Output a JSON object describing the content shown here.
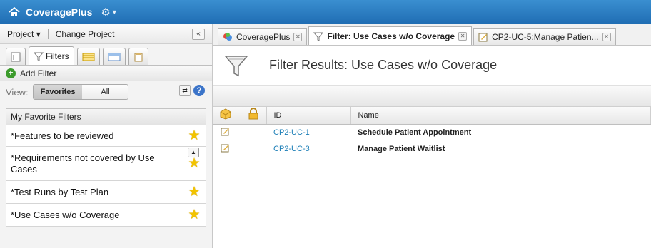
{
  "app": {
    "title": "CoveragePlus"
  },
  "project": {
    "project_label": "Project",
    "change_label": "Change Project"
  },
  "left_tabs": {
    "filters_label": "Filters"
  },
  "add_filter": {
    "label": "Add Filter"
  },
  "view": {
    "label": "View:",
    "options": [
      "Favorites",
      "All"
    ],
    "selected": "Favorites"
  },
  "favorites": {
    "header": "My Favorite Filters",
    "items": [
      {
        "label": "*Features to be reviewed"
      },
      {
        "label": "*Requirements not covered by Use Cases"
      },
      {
        "label": "*Test Runs by Test Plan"
      },
      {
        "label": "*Use Cases w/o Coverage"
      }
    ]
  },
  "doc_tabs": [
    {
      "label": "CoveragePlus"
    },
    {
      "label": "Filter: Use Cases w/o Coverage"
    },
    {
      "label": "CP2-UC-5:Manage Patien..."
    }
  ],
  "results": {
    "title": "Filter Results: Use Cases w/o Coverage",
    "columns": [
      "ID",
      "Name"
    ],
    "rows": [
      {
        "id": "CP2-UC-1",
        "name": "Schedule Patient Appointment"
      },
      {
        "id": "CP2-UC-3",
        "name": "Manage Patient Waitlist"
      }
    ]
  },
  "colors": {
    "topbar": "#2a7fc4",
    "link": "#1d7fb7",
    "star": "#f2c300"
  },
  "icons": [
    "home-icon",
    "gear-icon",
    "add-circle-icon",
    "refresh-icon",
    "help-icon",
    "star-icon",
    "funnel-icon",
    "edit-icon",
    "package-icon",
    "lock-icon"
  ]
}
